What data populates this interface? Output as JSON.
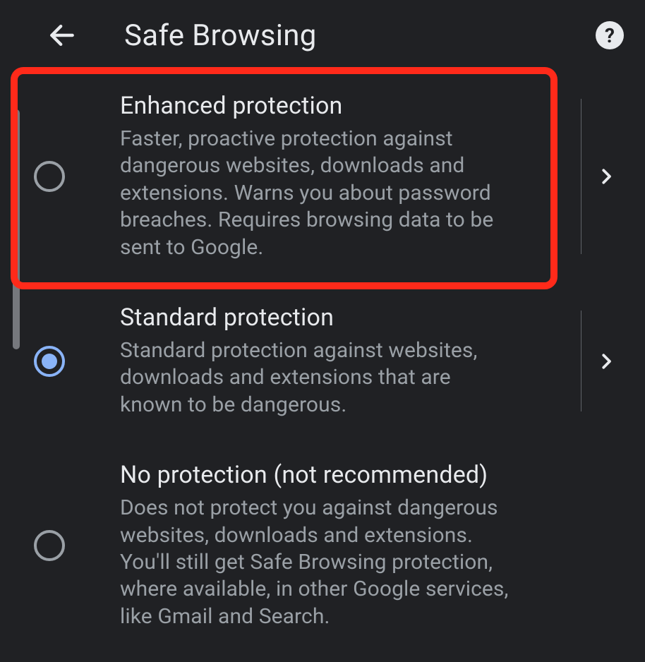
{
  "header": {
    "title": "Safe Browsing",
    "help_label": "?"
  },
  "options": [
    {
      "id": "enhanced",
      "title": "Enhanced protection",
      "description": "Faster, proactive protection against dangerous websites, downloads and extensions. Warns you about password breaches. Requires browsing data to be sent to Google.",
      "selected": false,
      "has_detail": true,
      "highlighted": true
    },
    {
      "id": "standard",
      "title": "Standard protection",
      "description": "Standard protection against websites, downloads and extensions that are known to be dangerous.",
      "selected": true,
      "has_detail": true,
      "highlighted": false
    },
    {
      "id": "none",
      "title": "No protection (not recommended)",
      "description": "Does not protect you against dangerous websites, downloads and extensions. You'll still get Safe Browsing protection, where available, in other Google services, like Gmail and Search.",
      "selected": false,
      "has_detail": false,
      "highlighted": false
    }
  ],
  "icons": {
    "back": "back-arrow-icon",
    "help": "help-icon",
    "chevron": "chevron-right-icon"
  },
  "colors": {
    "background": "#202124",
    "text_primary": "#e8eaed",
    "text_secondary": "#9aa0a6",
    "accent": "#8ab4f8",
    "highlight_border": "#ff2a1a"
  }
}
